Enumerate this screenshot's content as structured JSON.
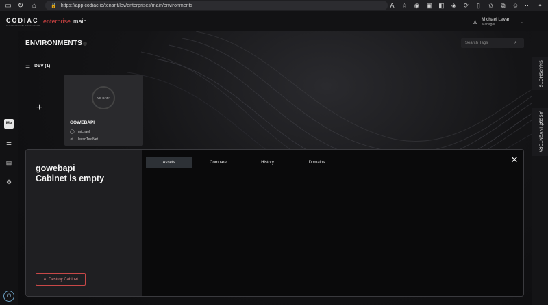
{
  "browser": {
    "url": "https://app.codiac.io/tenant/lev/enterprises/main/environments",
    "icons": [
      "panel-icon",
      "refresh-icon",
      "home-icon"
    ]
  },
  "header": {
    "logo": "CODIAC",
    "logo_sub": "CLOUD CABINET COMPLIANCE",
    "org": "enterprise",
    "space": "main",
    "user_name": "Michael Levan",
    "user_role": "Manager"
  },
  "left_rail": {
    "me_label": "Me"
  },
  "right_rail": {
    "tabs": [
      "SNAPSHOTS",
      "ASSET INVENTORY"
    ]
  },
  "main": {
    "title": "ENVIRONMENTS",
    "search_placeholder": "Search Tags",
    "env_label": "DEV (1)",
    "card": {
      "nodata": "NO DATA",
      "title": "GOWEBAPI",
      "owner": "michael",
      "network": "levanTestNet"
    }
  },
  "modal": {
    "title_line1": "gowebapi",
    "title_line2": "Cabinet is empty",
    "tabs": [
      {
        "label": "Assets",
        "active": true
      },
      {
        "label": "Compare",
        "active": false
      },
      {
        "label": "History",
        "active": false
      },
      {
        "label": "Domains",
        "active": false
      }
    ],
    "destroy_label": "Destroy Cabinet"
  },
  "colors": {
    "accent_red": "#d64545",
    "tab_underline": "#8fb9dd",
    "power": "#9cc7e6"
  }
}
